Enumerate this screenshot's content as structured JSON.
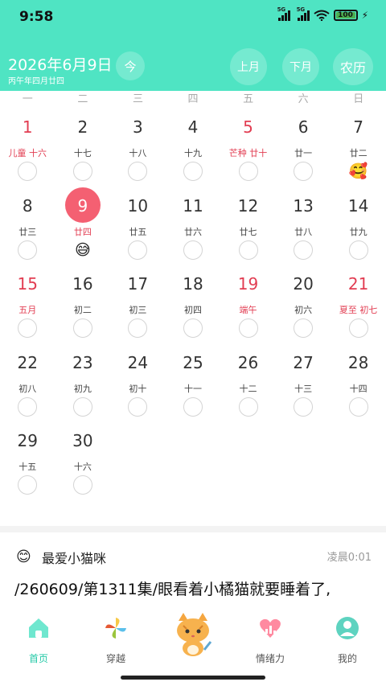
{
  "status": {
    "time": "9:58",
    "net1": "5G",
    "net2": "5G",
    "battery": "100"
  },
  "header": {
    "date": "2026年6月9日",
    "lunar_date": "丙午年四月廿四",
    "today_btn": "今",
    "prev_btn": "上月",
    "next_btn": "下月",
    "lunar_btn": "农历"
  },
  "weekdays": [
    "一",
    "二",
    "三",
    "四",
    "五",
    "六",
    "日"
  ],
  "calendar": {
    "rows": [
      [
        {
          "num": "1",
          "lunar": "儿童 十六",
          "red": true
        },
        {
          "num": "2",
          "lunar": "十七"
        },
        {
          "num": "3",
          "lunar": "十八"
        },
        {
          "num": "4",
          "lunar": "十九"
        },
        {
          "num": "5",
          "lunar": "芒种 廿十",
          "red": true
        },
        {
          "num": "6",
          "lunar": "廿一"
        },
        {
          "num": "7",
          "lunar": "廿二",
          "emoji": "🥰"
        }
      ],
      [
        {
          "num": "8",
          "lunar": "廿三"
        },
        {
          "num": "9",
          "lunar": "廿四",
          "selected": true,
          "emoji": "😅"
        },
        {
          "num": "10",
          "lunar": "廿五"
        },
        {
          "num": "11",
          "lunar": "廿六"
        },
        {
          "num": "12",
          "lunar": "廿七"
        },
        {
          "num": "13",
          "lunar": "廿八"
        },
        {
          "num": "14",
          "lunar": "廿九"
        }
      ],
      [
        {
          "num": "15",
          "lunar": "五月",
          "red": true
        },
        {
          "num": "16",
          "lunar": "初二"
        },
        {
          "num": "17",
          "lunar": "初三"
        },
        {
          "num": "18",
          "lunar": "初四"
        },
        {
          "num": "19",
          "lunar": "端午",
          "red": true
        },
        {
          "num": "20",
          "lunar": "初六"
        },
        {
          "num": "21",
          "lunar": "夏至 初七",
          "red": true
        }
      ],
      [
        {
          "num": "22",
          "lunar": "初八"
        },
        {
          "num": "23",
          "lunar": "初九"
        },
        {
          "num": "24",
          "lunar": "初十"
        },
        {
          "num": "25",
          "lunar": "十一"
        },
        {
          "num": "26",
          "lunar": "十二"
        },
        {
          "num": "27",
          "lunar": "十三"
        },
        {
          "num": "28",
          "lunar": "十四"
        }
      ],
      [
        {
          "num": "29",
          "lunar": "十五"
        },
        {
          "num": "30",
          "lunar": "十六"
        }
      ]
    ]
  },
  "post": {
    "avatar_emoji": "😊",
    "author": "最爱小猫咪",
    "time": "凌晨0:01",
    "text": "/260609/第1311集/眼看着小橘猫就要睡着了,"
  },
  "tabs": [
    {
      "label": "首页",
      "icon": "home-icon",
      "active": true
    },
    {
      "label": "穿越",
      "icon": "pinwheel-icon"
    },
    {
      "label": "",
      "icon": "cat-mascot-icon"
    },
    {
      "label": "情绪力",
      "icon": "heart-chart-icon"
    },
    {
      "label": "我的",
      "icon": "profile-icon"
    }
  ],
  "colors": {
    "accent": "#4fe4c3",
    "selected": "#f46072",
    "holiday": "#e23d52",
    "tab_active": "#24c9a7"
  }
}
